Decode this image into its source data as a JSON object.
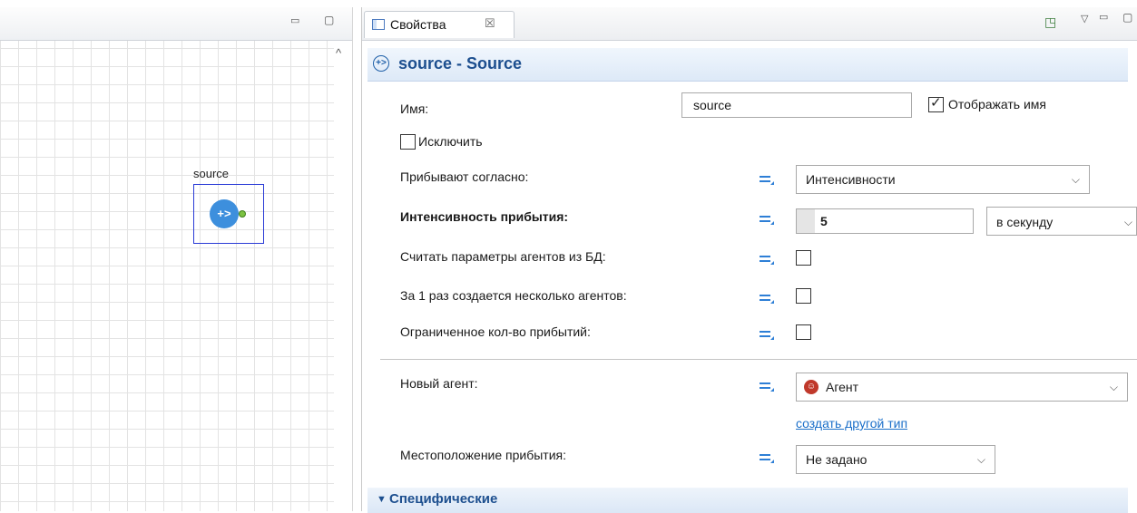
{
  "left_editor": {
    "block_label": "source",
    "block_icon_text": "+>"
  },
  "properties": {
    "tab_label": "Свойства",
    "tab_close": "☒",
    "title_icon": "+>",
    "title": "source - Source",
    "name": {
      "label": "Имя:",
      "value": "source",
      "show_name_label": "Отображать имя",
      "show_name_checked": true
    },
    "exclude": {
      "label": "Исключить",
      "checked": false
    },
    "arrivals": {
      "label": "Прибывают согласно:",
      "value": "Интенсивности"
    },
    "rate": {
      "label": "Интенсивность прибытия:",
      "value": "5",
      "unit": "в секунду"
    },
    "read_db": {
      "label": "Считать параметры агентов из БД:",
      "checked": false
    },
    "multiple": {
      "label": "За 1 раз создается несколько агентов:",
      "checked": false
    },
    "limited": {
      "label": "Ограниченное кол-во прибытий:",
      "checked": false
    },
    "new_agent": {
      "label": "Новый агент:",
      "value": "Агент",
      "create_link": "создать другой тип"
    },
    "location": {
      "label": "Местоположение прибытия:",
      "value": "Не задано"
    },
    "section": {
      "label": "Специфические"
    }
  },
  "icons": {
    "minimize": "minimize-icon",
    "maximize": "maximize-icon",
    "view_menu": "view-menu-icon",
    "dynamic": "dynamic-value-icon",
    "agent": "agent-icon"
  },
  "colors": {
    "accent": "#1d4f8f",
    "link": "#1b6fc9",
    "selection": "#2a3bd6",
    "source_icon": "#3d8fdd"
  }
}
